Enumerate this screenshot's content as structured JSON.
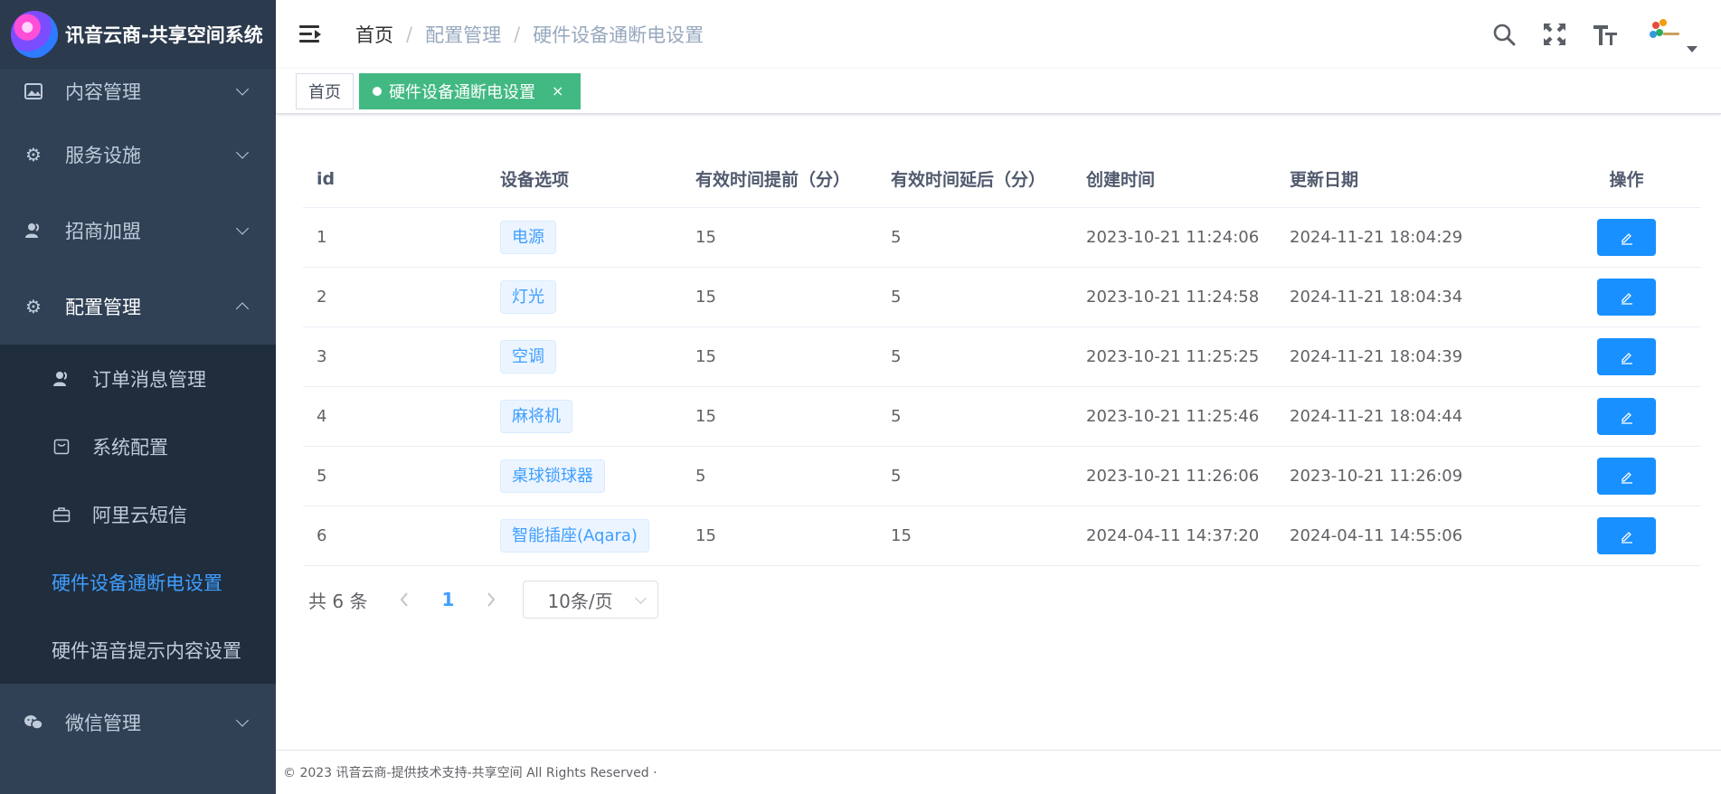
{
  "app": {
    "title": "讯音云商-共享空间系统"
  },
  "sidebar": {
    "items": [
      {
        "label": "内容管理",
        "icon": "image-icon"
      },
      {
        "label": "服务设施",
        "icon": "gear-icon"
      },
      {
        "label": "招商加盟",
        "icon": "user-icon"
      },
      {
        "label": "配置管理",
        "icon": "gear-icon",
        "expanded": true
      }
    ],
    "sub_items": [
      {
        "label": "订单消息管理",
        "icon": "user-icon"
      },
      {
        "label": "系统配置",
        "icon": "box-icon"
      },
      {
        "label": "阿里云短信",
        "icon": "briefcase-icon"
      },
      {
        "label": "硬件设备通断电设置",
        "active": true
      },
      {
        "label": "硬件语音提示内容设置"
      }
    ],
    "bottom_item": {
      "label": "微信管理",
      "icon": "wechat-icon"
    },
    "active_color": "#409eff"
  },
  "breadcrumb": [
    "首页",
    "配置管理",
    "硬件设备通断电设置"
  ],
  "breadcrumb_sep": "/",
  "tags": {
    "home": "首页",
    "active": "硬件设备通断电设置",
    "close": "×",
    "active_color": "#42b983"
  },
  "table": {
    "headers": [
      "id",
      "设备选项",
      "有效时间提前（分）",
      "有效时间延后（分）",
      "创建时间",
      "更新日期",
      "操作"
    ],
    "rows": [
      {
        "id": "1",
        "device": "电源",
        "before": "15",
        "after": "5",
        "created": "2023-10-21 11:24:06",
        "updated": "2024-11-21 18:04:29"
      },
      {
        "id": "2",
        "device": "灯光",
        "before": "15",
        "after": "5",
        "created": "2023-10-21 11:24:58",
        "updated": "2024-11-21 18:04:34"
      },
      {
        "id": "3",
        "device": "空调",
        "before": "15",
        "after": "5",
        "created": "2023-10-21 11:25:25",
        "updated": "2024-11-21 18:04:39"
      },
      {
        "id": "4",
        "device": "麻将机",
        "before": "15",
        "after": "5",
        "created": "2023-10-21 11:25:46",
        "updated": "2024-11-21 18:04:44"
      },
      {
        "id": "5",
        "device": "桌球锁球器",
        "before": "5",
        "after": "5",
        "created": "2023-10-21 11:26:06",
        "updated": "2023-10-21 11:26:09"
      },
      {
        "id": "6",
        "device": "智能插座(Aqara)",
        "before": "15",
        "after": "15",
        "created": "2024-04-11 14:37:20",
        "updated": "2024-04-11 14:55:06"
      }
    ],
    "edit_icon": "edit-icon",
    "button_color": "#1890ff"
  },
  "pagination": {
    "total": "共 6 条",
    "current": "1",
    "page_size": "10条/页"
  },
  "footer": {
    "text": "© 2023 讯音云商-提供技术支持-共享空间 All Rights Reserved ·"
  }
}
